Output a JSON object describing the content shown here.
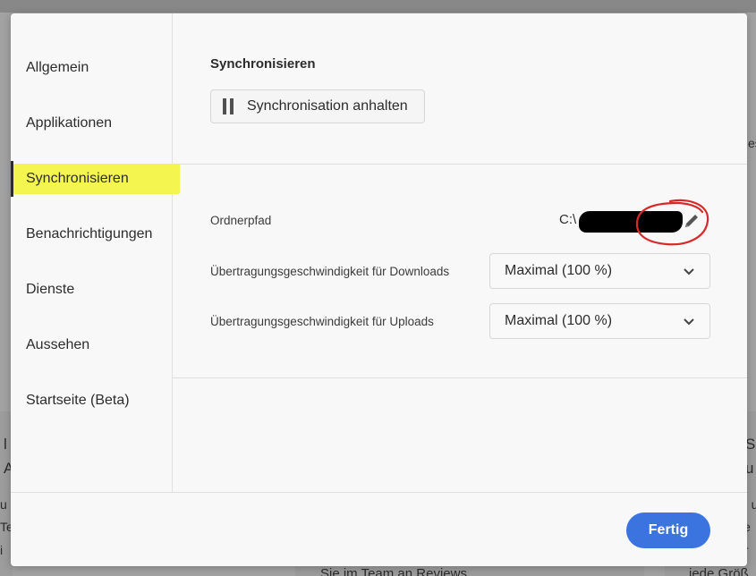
{
  "sidebar": {
    "items": [
      {
        "label": "Allgemein"
      },
      {
        "label": "Applikationen"
      },
      {
        "label": "Synchronisieren"
      },
      {
        "label": "Benachrichtigungen"
      },
      {
        "label": "Dienste"
      },
      {
        "label": "Aussehen"
      },
      {
        "label": "Startseite (Beta)"
      }
    ],
    "active": "Synchronisieren"
  },
  "sync": {
    "title": "Synchronisieren",
    "pause_label": "Synchronisation anhalten",
    "folder_path_label": "Ordnerpfad",
    "folder_path_value": "C:\\",
    "download_label": "Übertragungsgeschwindigkeit für Downloads",
    "download_value": "Maximal (100 %)",
    "upload_label": "Übertragungsgeschwindigkeit für Uploads",
    "upload_value": "Maximal (100 %)"
  },
  "footer": {
    "done_label": "Fertig"
  },
  "background": {
    "frag_right_top": "es",
    "frag_left_1": "l",
    "frag_left_2": "A",
    "frag_left_3": "u",
    "frag_left_4": "Te",
    "frag_left_5": "i",
    "frag_right_1": "Sa",
    "frag_right_2": "u",
    "frag_right_3": "n u",
    "frag_right_4": "ie",
    "frag_right_5": "Ir",
    "frag_bottom_mid": "Sie im Team an Reviews",
    "frag_bottom_right": "jede Größ"
  },
  "colors": {
    "accent": "#3b73df",
    "highlight": "#f4f64f",
    "annotation": "#d62a2a"
  }
}
